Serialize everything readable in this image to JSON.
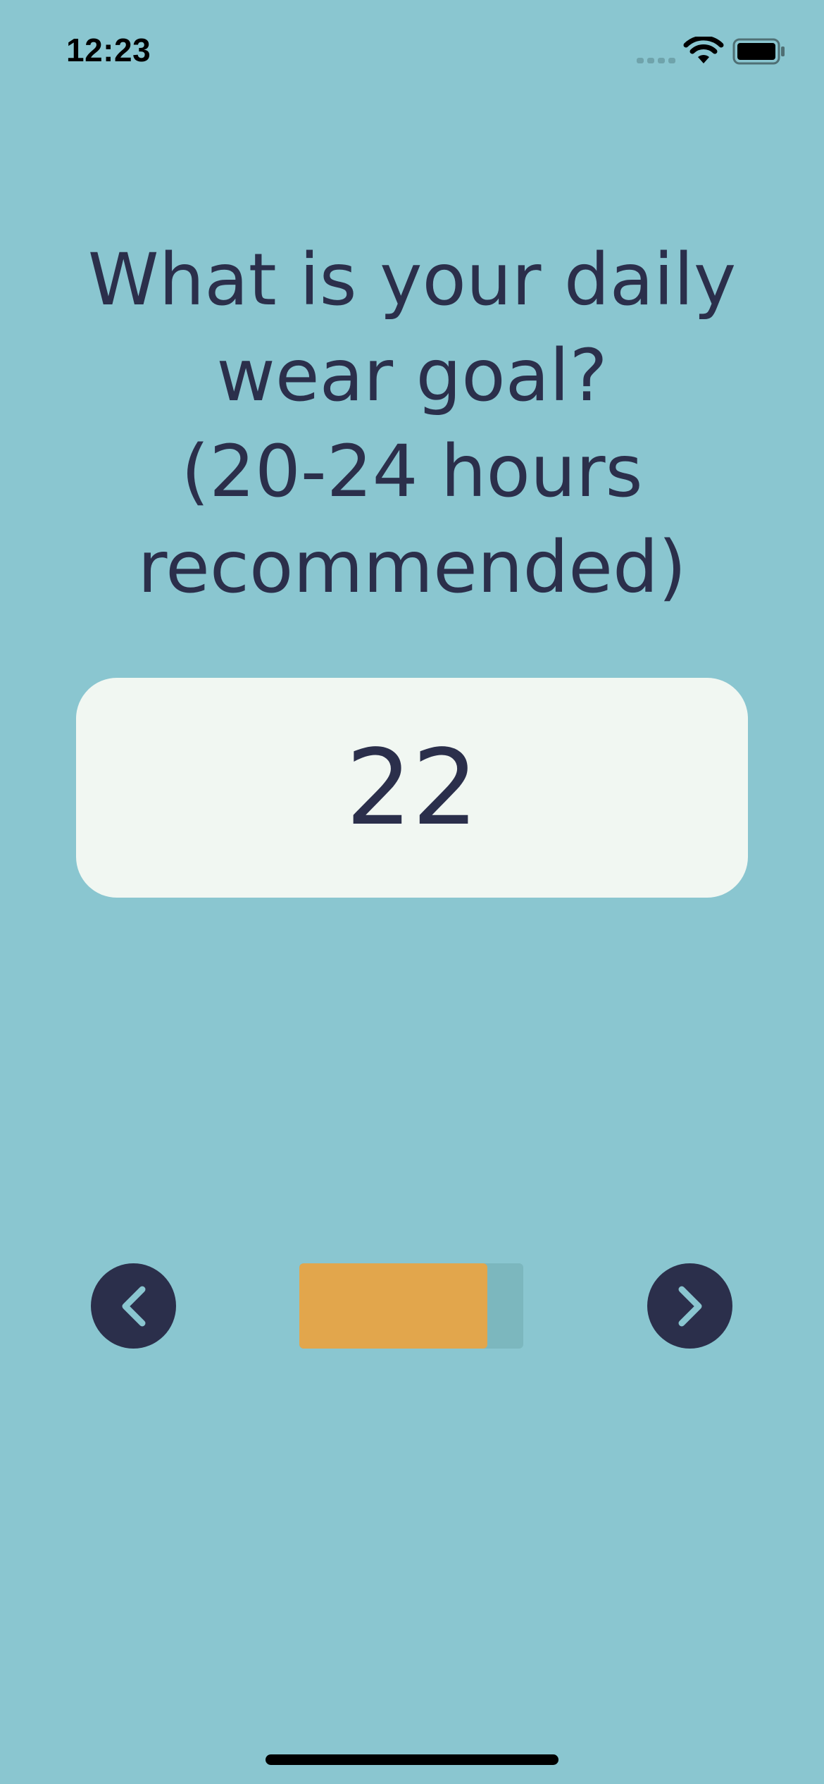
{
  "status_bar": {
    "time": "12:23",
    "icons": [
      "signal-icon",
      "wifi-icon",
      "battery-icon"
    ]
  },
  "question": {
    "text": "What is your daily\nwear goal?\n(20-24 hours\nrecommended)"
  },
  "goal": {
    "value": "22"
  },
  "navigation": {
    "prev_icon": "chevron-left-icon",
    "next_icon": "chevron-right-icon"
  },
  "progress": {
    "fraction": 0.84
  },
  "colors": {
    "background": "#8ac6d0",
    "text": "#2b2f4b",
    "card": "#f1f7f2",
    "button": "#2b2f4b",
    "chevron": "#8ac6d0",
    "progress_fill": "#e2a64c",
    "progress_track": "#7cb7be"
  }
}
